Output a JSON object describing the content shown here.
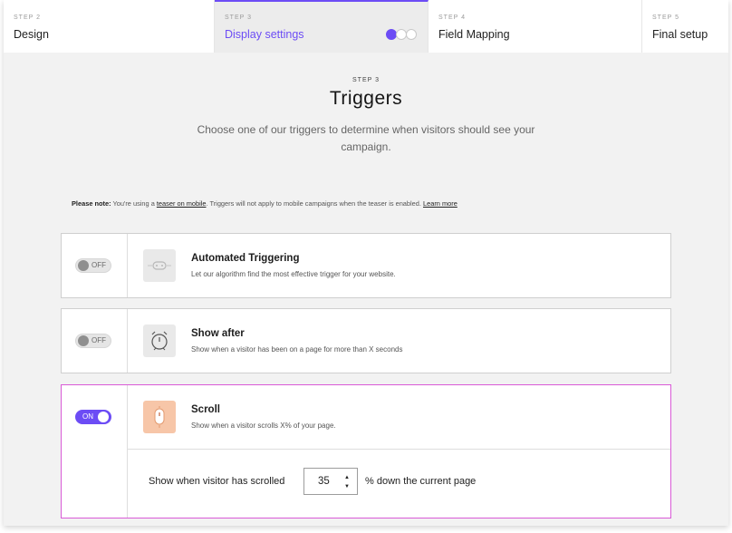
{
  "steps": [
    {
      "num": "STEP 2",
      "name": "Design"
    },
    {
      "num": "STEP 3",
      "name": "Display settings"
    },
    {
      "num": "STEP 4",
      "name": "Field Mapping"
    },
    {
      "num": "STEP 5",
      "name": "Final setup"
    }
  ],
  "step_progress": {
    "filled": 1,
    "total": 3
  },
  "header": {
    "step": "STEP 3",
    "title": "Triggers",
    "subtitle": "Choose one of our triggers to determine when visitors should see your campaign."
  },
  "note": {
    "bold": "Please note:",
    "text1": " You're using a ",
    "link1": "teaser on mobile",
    "text2": ". Triggers will not apply to mobile campaigns when the teaser is enabled. ",
    "link2": "Learn more"
  },
  "triggers": [
    {
      "toggle": "OFF",
      "title": "Automated Triggering",
      "desc": "Let our algorithm find the most effective trigger for your website.",
      "icon": "robot-icon"
    },
    {
      "toggle": "OFF",
      "title": "Show after",
      "desc": "Show when a visitor has been on a page for more than X seconds",
      "icon": "alarm-clock-icon"
    },
    {
      "toggle": "ON",
      "title": "Scroll",
      "desc": "Show when a visitor scrolls X% of your page.",
      "icon": "scroll-mouse-icon"
    }
  ],
  "scroll_setting": {
    "label_before": "Show when visitor has scrolled",
    "value": "35",
    "label_after": "% down the current page"
  },
  "colors": {
    "accent": "#6c4cf5",
    "active_border": "#d95ad7",
    "icon_orange": "#f7c6a8"
  }
}
